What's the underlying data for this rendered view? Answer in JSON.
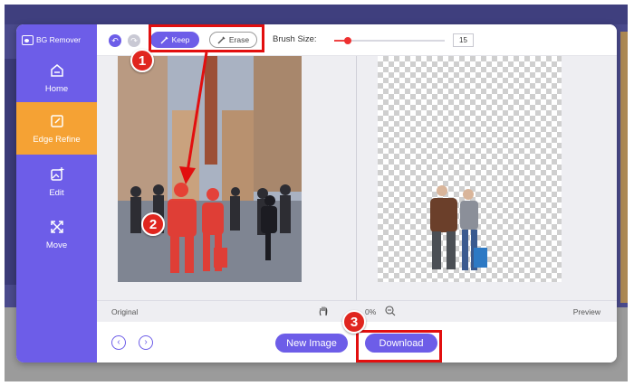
{
  "app": {
    "brand": "BG Remover",
    "sidebar": {
      "items": [
        {
          "label": "Home",
          "icon": "home-icon"
        },
        {
          "label": "Edge Refine",
          "icon": "edge-refine-icon"
        },
        {
          "label": "Edit",
          "icon": "edit-image-icon"
        },
        {
          "label": "Move",
          "icon": "move-icon"
        }
      ],
      "active_item": "Edge Refine"
    },
    "toolbar": {
      "keep_label": "Keep",
      "erase_label": "Erase",
      "brush_label": "Brush Size:",
      "brush_value": "15",
      "brush_level_fraction": 0.12
    },
    "status": {
      "original_label": "Original",
      "zoom_text": "0%",
      "preview_label": "Preview"
    },
    "bottom": {
      "new_image_label": "New Image",
      "download_label": "Download"
    }
  },
  "annotations": {
    "badges": [
      "1",
      "2",
      "3"
    ]
  },
  "colors": {
    "accent": "#6d5de8",
    "active_nav": "#f5a234",
    "highlight": "#e20f0f"
  }
}
